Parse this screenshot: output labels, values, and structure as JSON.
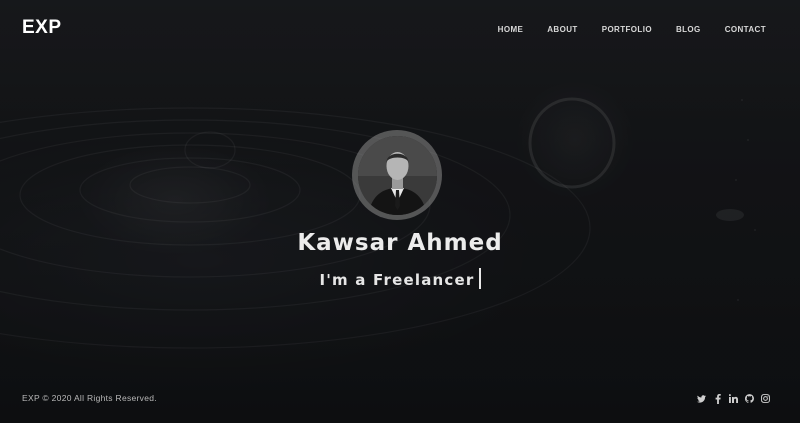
{
  "header": {
    "logo": "EXP",
    "nav": [
      "HOME",
      "ABOUT",
      "PORTFOLIO",
      "BLOG",
      "CONTACT"
    ]
  },
  "hero": {
    "name": "Kawsar Ahmed",
    "tagline": "I'm a Freelancer"
  },
  "footer": {
    "copyright": "EXP © 2020 All Rights Reserved."
  },
  "social_icons": [
    "twitter-icon",
    "facebook-icon",
    "linkedin-icon",
    "github-icon",
    "instagram-icon"
  ],
  "colors": {
    "background": "#1b1d21",
    "text": "#ececec"
  }
}
